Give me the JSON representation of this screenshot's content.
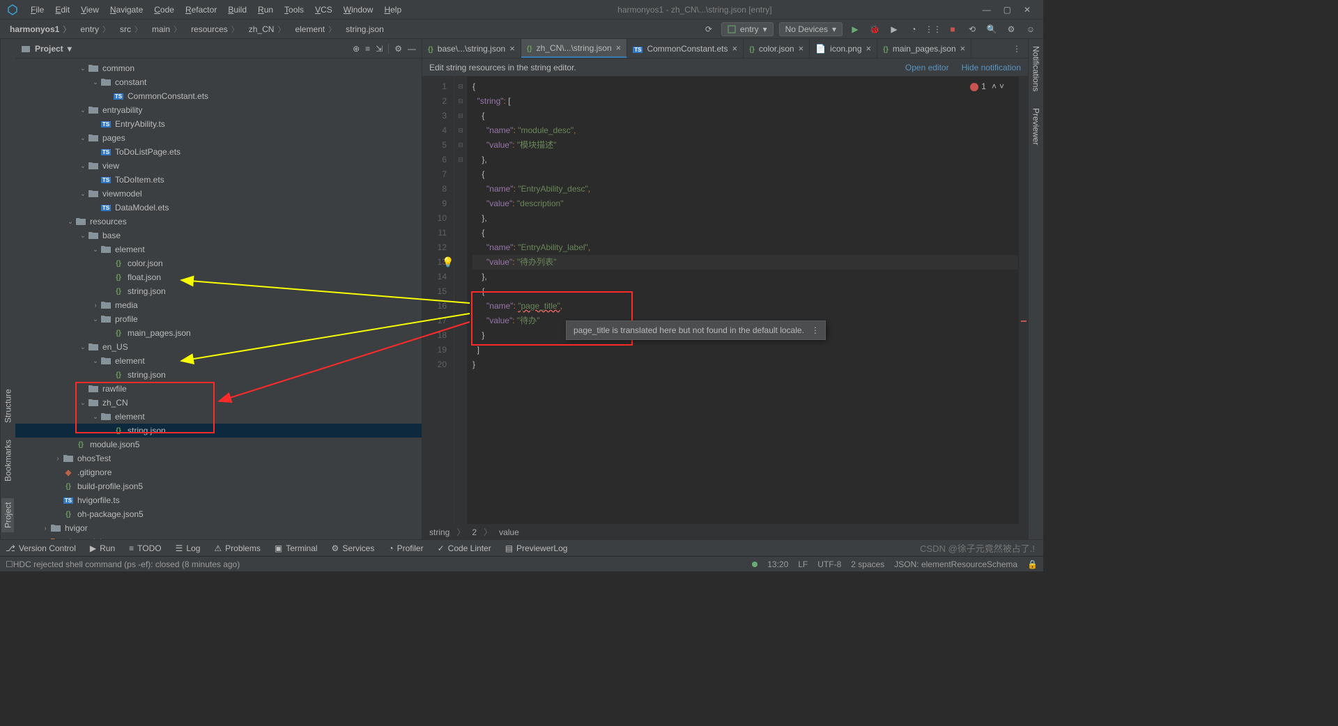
{
  "window_title": "harmonyos1 - zh_CN\\...\\string.json [entry]",
  "menu": [
    "File",
    "Edit",
    "View",
    "Navigate",
    "Code",
    "Refactor",
    "Build",
    "Run",
    "Tools",
    "VCS",
    "Window",
    "Help"
  ],
  "breadcrumb": [
    "harmonyos1",
    "entry",
    "src",
    "main",
    "resources",
    "zh_CN",
    "element",
    "string.json"
  ],
  "run_config": {
    "module": "entry",
    "device": "No Devices"
  },
  "sidebar": {
    "title": "Project",
    "tools": [
      "target-icon",
      "select-opened-icon",
      "expand-all-icon",
      "collapse-all-icon",
      "settings-icon",
      "hide-icon"
    ]
  },
  "tree": [
    {
      "d": 5,
      "a": "v",
      "t": "folder",
      "l": "common"
    },
    {
      "d": 6,
      "a": "v",
      "t": "folder",
      "l": "constant"
    },
    {
      "d": 7,
      "a": "",
      "t": "ts",
      "l": "CommonConstant.ets"
    },
    {
      "d": 5,
      "a": "v",
      "t": "folder",
      "l": "entryability"
    },
    {
      "d": 6,
      "a": "",
      "t": "ts",
      "l": "EntryAbility.ts"
    },
    {
      "d": 5,
      "a": "v",
      "t": "folder",
      "l": "pages"
    },
    {
      "d": 6,
      "a": "",
      "t": "ts",
      "l": "ToDoListPage.ets"
    },
    {
      "d": 5,
      "a": "v",
      "t": "folder",
      "l": "view"
    },
    {
      "d": 6,
      "a": "",
      "t": "ts",
      "l": "ToDoItem.ets"
    },
    {
      "d": 5,
      "a": "v",
      "t": "folder",
      "l": "viewmodel"
    },
    {
      "d": 6,
      "a": "",
      "t": "ts",
      "l": "DataModel.ets"
    },
    {
      "d": 4,
      "a": "v",
      "t": "folder",
      "l": "resources"
    },
    {
      "d": 5,
      "a": "v",
      "t": "folder",
      "l": "base"
    },
    {
      "d": 6,
      "a": "v",
      "t": "folder",
      "l": "element"
    },
    {
      "d": 7,
      "a": "",
      "t": "json",
      "l": "color.json"
    },
    {
      "d": 7,
      "a": "",
      "t": "json",
      "l": "float.json"
    },
    {
      "d": 7,
      "a": "",
      "t": "json",
      "l": "string.json"
    },
    {
      "d": 6,
      "a": ">",
      "t": "folder",
      "l": "media"
    },
    {
      "d": 6,
      "a": "v",
      "t": "folder",
      "l": "profile"
    },
    {
      "d": 7,
      "a": "",
      "t": "json",
      "l": "main_pages.json"
    },
    {
      "d": 5,
      "a": "v",
      "t": "folder",
      "l": "en_US"
    },
    {
      "d": 6,
      "a": "v",
      "t": "folder",
      "l": "element"
    },
    {
      "d": 7,
      "a": "",
      "t": "json",
      "l": "string.json"
    },
    {
      "d": 5,
      "a": "",
      "t": "folder",
      "l": "rawfile"
    },
    {
      "d": 5,
      "a": "v",
      "t": "folder",
      "l": "zh_CN"
    },
    {
      "d": 6,
      "a": "v",
      "t": "folder",
      "l": "element"
    },
    {
      "d": 7,
      "a": "",
      "t": "json",
      "l": "string.json",
      "sel": true
    },
    {
      "d": 4,
      "a": "",
      "t": "json5",
      "l": "module.json5"
    },
    {
      "d": 3,
      "a": ">",
      "t": "folder",
      "l": "ohosTest"
    },
    {
      "d": 3,
      "a": "",
      "t": "git",
      "l": ".gitignore"
    },
    {
      "d": 3,
      "a": "",
      "t": "json5",
      "l": "build-profile.json5"
    },
    {
      "d": 3,
      "a": "",
      "t": "ts",
      "l": "hvigorfile.ts"
    },
    {
      "d": 3,
      "a": "",
      "t": "json5",
      "l": "oh-package.json5"
    },
    {
      "d": 2,
      "a": ">",
      "t": "folder",
      "l": "hvigor"
    },
    {
      "d": 2,
      "a": ">",
      "t": "folder-o",
      "l": "oh_modules"
    }
  ],
  "tabs": [
    {
      "label": "base\\...\\string.json",
      "icon": "json"
    },
    {
      "label": "zh_CN\\...\\string.json",
      "icon": "json",
      "active": true
    },
    {
      "label": "CommonConstant.ets",
      "icon": "ts"
    },
    {
      "label": "color.json",
      "icon": "json"
    },
    {
      "label": "icon.png",
      "icon": "img"
    },
    {
      "label": "main_pages.json",
      "icon": "json"
    }
  ],
  "notice": {
    "text": "Edit string resources in the string editor.",
    "open": "Open editor",
    "hide": "Hide notification"
  },
  "error_count": "1",
  "code_lines": [
    {
      "n": 1,
      "seg": [
        [
          "brace",
          "{"
        ]
      ]
    },
    {
      "n": 2,
      "seg": [
        [
          "indent",
          "  "
        ],
        [
          "key",
          "\"string\""
        ],
        [
          "punct",
          ": "
        ],
        [
          "brace",
          "["
        ]
      ]
    },
    {
      "n": 3,
      "seg": [
        [
          "indent",
          "    "
        ],
        [
          "brace",
          "{"
        ]
      ]
    },
    {
      "n": 4,
      "seg": [
        [
          "indent",
          "      "
        ],
        [
          "key",
          "\"name\""
        ],
        [
          "punct",
          ": "
        ],
        [
          "str",
          "\"module_desc\""
        ],
        [
          "punct",
          ","
        ]
      ]
    },
    {
      "n": 5,
      "seg": [
        [
          "indent",
          "      "
        ],
        [
          "key",
          "\"value\""
        ],
        [
          "punct",
          ": "
        ],
        [
          "str",
          "\"模块描述\""
        ]
      ]
    },
    {
      "n": 6,
      "seg": [
        [
          "indent",
          "    "
        ],
        [
          "brace",
          "},"
        ]
      ]
    },
    {
      "n": 7,
      "seg": [
        [
          "indent",
          "    "
        ],
        [
          "brace",
          "{"
        ]
      ]
    },
    {
      "n": 8,
      "seg": [
        [
          "indent",
          "      "
        ],
        [
          "key",
          "\"name\""
        ],
        [
          "punct",
          ": "
        ],
        [
          "str",
          "\"EntryAbility_desc\""
        ],
        [
          "punct",
          ","
        ]
      ]
    },
    {
      "n": 9,
      "seg": [
        [
          "indent",
          "      "
        ],
        [
          "key",
          "\"value\""
        ],
        [
          "punct",
          ": "
        ],
        [
          "str",
          "\"description\""
        ]
      ]
    },
    {
      "n": 10,
      "seg": [
        [
          "indent",
          "    "
        ],
        [
          "brace",
          "},"
        ]
      ]
    },
    {
      "n": 11,
      "seg": [
        [
          "indent",
          "    "
        ],
        [
          "brace",
          "{"
        ]
      ]
    },
    {
      "n": 12,
      "seg": [
        [
          "indent",
          "      "
        ],
        [
          "key",
          "\"name\""
        ],
        [
          "punct",
          ": "
        ],
        [
          "str",
          "\"EntryAbility_label\""
        ],
        [
          "punct",
          ","
        ]
      ]
    },
    {
      "n": 13,
      "hl": true,
      "bulb": true,
      "seg": [
        [
          "indent",
          "      "
        ],
        [
          "key",
          "\"value\""
        ],
        [
          "punct",
          ": "
        ],
        [
          "str",
          "\"待办列表\""
        ]
      ]
    },
    {
      "n": 14,
      "seg": [
        [
          "indent",
          "    "
        ],
        [
          "brace",
          "},"
        ]
      ]
    },
    {
      "n": 15,
      "seg": [
        [
          "indent",
          "    "
        ],
        [
          "brace",
          "{"
        ]
      ]
    },
    {
      "n": 16,
      "seg": [
        [
          "indent",
          "      "
        ],
        [
          "key",
          "\"name\""
        ],
        [
          "punct",
          ": "
        ],
        [
          "err",
          "\"page_title\""
        ],
        [
          "punct",
          ","
        ]
      ]
    },
    {
      "n": 17,
      "seg": [
        [
          "indent",
          "      "
        ],
        [
          "key",
          "\"value\""
        ],
        [
          "punct",
          ": "
        ],
        [
          "str",
          "\"待办\""
        ]
      ]
    },
    {
      "n": 18,
      "seg": [
        [
          "indent",
          "    "
        ],
        [
          "brace",
          "}"
        ]
      ]
    },
    {
      "n": 19,
      "seg": [
        [
          "indent",
          "  "
        ],
        [
          "brace",
          "]"
        ]
      ]
    },
    {
      "n": 20,
      "seg": [
        [
          "brace",
          "}"
        ]
      ]
    }
  ],
  "hint_text": "page_title is translated here but not found in the default locale.",
  "code_crumb": [
    "string",
    "2",
    "value"
  ],
  "left_tabs": [
    "Project",
    "Bookmarks",
    "Structure"
  ],
  "right_tabs": [
    "Notifications",
    "Previewer"
  ],
  "bottom_tools": [
    {
      "icon": "branch",
      "label": "Version Control"
    },
    {
      "icon": "play",
      "label": "Run"
    },
    {
      "icon": "todo",
      "label": "TODO"
    },
    {
      "icon": "log",
      "label": "Log"
    },
    {
      "icon": "warn",
      "label": "Problems"
    },
    {
      "icon": "term",
      "label": "Terminal"
    },
    {
      "icon": "srv",
      "label": "Services"
    },
    {
      "icon": "prof",
      "label": "Profiler"
    },
    {
      "icon": "lint",
      "label": "Code Linter"
    },
    {
      "icon": "prev",
      "label": "PreviewerLog"
    }
  ],
  "status": {
    "msg": "HDC rejected shell command (ps -ef): closed (8 minutes ago)",
    "pos": "13:20",
    "lf": "LF",
    "enc": "UTF-8",
    "indent": "2 spaces",
    "schema": "JSON: elementResourceSchema"
  },
  "watermark": "CSDN @徐子元竟然被占了.!"
}
